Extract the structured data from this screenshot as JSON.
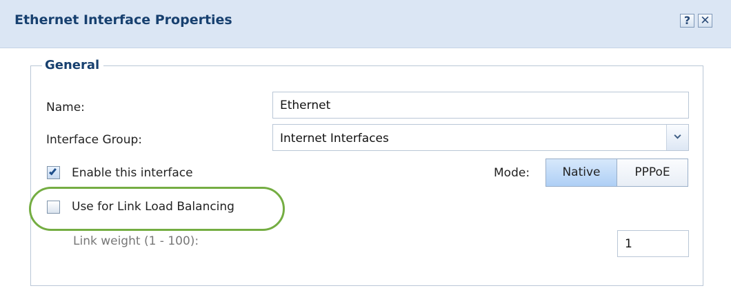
{
  "window": {
    "title": "Ethernet Interface Properties",
    "help_glyph": "?",
    "close_glyph": "✕"
  },
  "general": {
    "legend": "General",
    "name_label": "Name:",
    "name_value": "Ethernet",
    "interface_group_label": "Interface Group:",
    "interface_group_value": "Internet Interfaces",
    "enable_label": "Enable this interface",
    "enable_checked": true,
    "mode_label": "Mode:",
    "mode_options": [
      "Native",
      "PPPoE"
    ],
    "mode_selected": "Native",
    "link_balance_label": "Use for Link Load Balancing",
    "link_balance_checked": false,
    "link_weight_label": "Link weight (1 - 100):",
    "link_weight_value": "1"
  },
  "icons": {
    "help": "help-icon",
    "close": "close-icon",
    "dropdown": "chevron-down-icon",
    "check": "checkmark-icon"
  },
  "colors": {
    "title_text": "#17406f",
    "title_bar": "#dbe6f4",
    "border": "#b9c6d6",
    "highlight_ring": "#74ad42",
    "selected_segment": "#aecff5"
  }
}
